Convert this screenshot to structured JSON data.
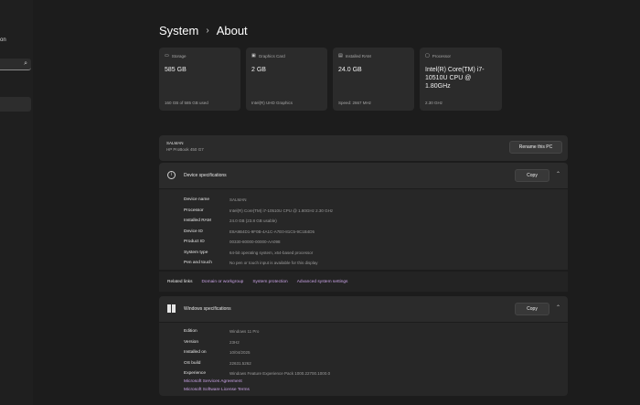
{
  "sidebar": {
    "partial_text": "on",
    "search_icon": "search-icon"
  },
  "breadcrumb": {
    "parent": "System",
    "separator": "›",
    "current": "About"
  },
  "cards": [
    {
      "icon": "storage-icon",
      "label": "Storage",
      "value": "585 GB",
      "sub": "160 GB of 585 GB used"
    },
    {
      "icon": "graphics-card-icon",
      "label": "Graphics Card",
      "value": "2 GB",
      "sub": "Intel(R) UHD Graphics"
    },
    {
      "icon": "ram-icon",
      "label": "Installed RAM",
      "value": "24.0 GB",
      "sub": "Speed: 2667 MHz"
    },
    {
      "icon": "processor-icon",
      "label": "Processor",
      "value": "Intel(R) Core(TM) i7-10510U CPU @ 1.80GHz",
      "sub": "2.30 GHz"
    }
  ],
  "device": {
    "name": "SALMAN",
    "model": "HP ProBook 450 G7",
    "rename_label": "Rename this PC"
  },
  "device_specs": {
    "title": "Device specifications",
    "copy_label": "Copy",
    "rows": [
      {
        "k": "Device name",
        "v": "SALMAN"
      },
      {
        "k": "Processor",
        "v": "Intel(R) Core(TM) i7-10510U CPU @ 1.80GHz   2.30 GHz"
      },
      {
        "k": "Installed RAM",
        "v": "24.0 GB (23.8 GB usable)"
      },
      {
        "k": "Device ID",
        "v": "E8A9B4D1-9F0B-4A1C-A7E0-81C5-9C1B4D5"
      },
      {
        "k": "Product ID",
        "v": "00330-80000-00000-AA098"
      },
      {
        "k": "System type",
        "v": "64-bit operating system, x64-based processor"
      },
      {
        "k": "Pen and touch",
        "v": "No pen or touch input is available for this display"
      }
    ]
  },
  "related_links": {
    "label": "Related links",
    "links": [
      "Domain or workgroup",
      "System protection",
      "Advanced system settings"
    ]
  },
  "windows_specs": {
    "title": "Windows specifications",
    "copy_label": "Copy",
    "rows": [
      {
        "k": "Edition",
        "v": "Windows 11 Pro"
      },
      {
        "k": "Version",
        "v": "23H2"
      },
      {
        "k": "Installed on",
        "v": "10/04/2025"
      },
      {
        "k": "OS build",
        "v": "22631.5262"
      },
      {
        "k": "Experience",
        "v": "Windows Feature Experience Pack 1000.22700.1000.0"
      }
    ],
    "links": [
      "Microsoft Services Agreement",
      "Microsoft Software License Terms"
    ]
  }
}
